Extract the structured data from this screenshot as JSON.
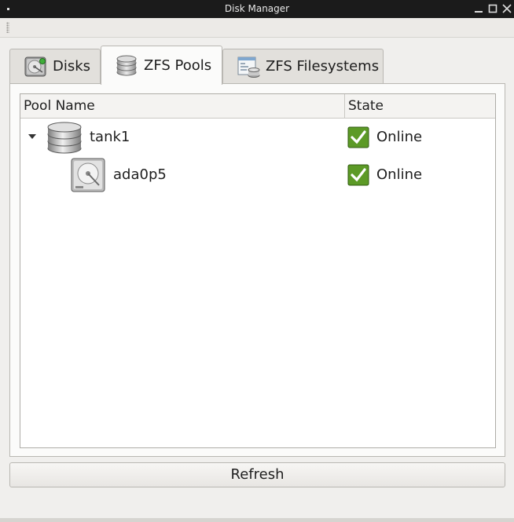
{
  "window": {
    "title": "Disk Manager"
  },
  "tabs": [
    {
      "label": "Disks",
      "icon": "hard-disk-icon",
      "active": false
    },
    {
      "label": "ZFS Pools",
      "icon": "pool-icon",
      "active": true
    },
    {
      "label": "ZFS Filesystems",
      "icon": "filesystem-icon",
      "active": false
    }
  ],
  "tree": {
    "columns": [
      "Pool Name",
      "State"
    ],
    "rows": [
      {
        "name": "tank1",
        "state": "Online",
        "icon": "pool-icon",
        "expanded": true,
        "level": 0
      },
      {
        "name": "ada0p5",
        "state": "Online",
        "icon": "hard-disk-icon",
        "level": 1
      }
    ]
  },
  "refresh_label": "Refresh",
  "colors": {
    "titlebar": "#1b1b1b",
    "check": "#4f8a1e"
  }
}
